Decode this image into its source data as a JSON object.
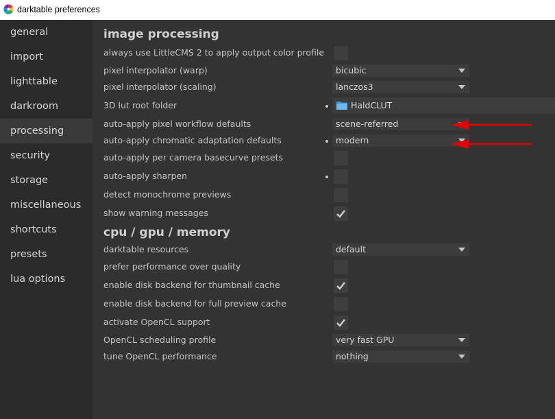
{
  "window": {
    "title": "darktable preferences"
  },
  "sidebar": {
    "items": [
      {
        "label": "general"
      },
      {
        "label": "import"
      },
      {
        "label": "lighttable"
      },
      {
        "label": "darkroom"
      },
      {
        "label": "processing",
        "active": true
      },
      {
        "label": "security"
      },
      {
        "label": "storage"
      },
      {
        "label": "miscellaneous"
      },
      {
        "label": "shortcuts"
      },
      {
        "label": "presets"
      },
      {
        "label": "lua options"
      }
    ]
  },
  "image_processing": {
    "title": "image processing",
    "rows": [
      {
        "label": "always use LittleCMS 2 to apply output color profile",
        "type": "checkbox",
        "checked": false
      },
      {
        "label": "pixel interpolator (warp)",
        "type": "select",
        "value": "bicubic"
      },
      {
        "label": "pixel interpolator (scaling)",
        "type": "select",
        "value": "lanczos3"
      },
      {
        "label": "3D lut root folder",
        "type": "folder",
        "value": "HaldCLUT",
        "modified": true
      },
      {
        "label": "auto-apply pixel workflow defaults",
        "type": "select",
        "value": "scene-referred"
      },
      {
        "label": "auto-apply chromatic adaptation defaults",
        "type": "select",
        "value": "modern",
        "modified": true
      },
      {
        "label": "auto-apply per camera basecurve presets",
        "type": "checkbox",
        "checked": false
      },
      {
        "label": "auto-apply sharpen",
        "type": "checkbox",
        "checked": false,
        "modified": true
      },
      {
        "label": "detect monochrome previews",
        "type": "checkbox",
        "checked": false
      },
      {
        "label": "show warning messages",
        "type": "checkbox",
        "checked": true
      }
    ]
  },
  "cpu_gpu_memory": {
    "title": "cpu / gpu / memory",
    "rows": [
      {
        "label": "darktable resources",
        "type": "select",
        "value": "default"
      },
      {
        "label": "prefer performance over quality",
        "type": "checkbox",
        "checked": false
      },
      {
        "label": "enable disk backend for thumbnail cache",
        "type": "checkbox",
        "checked": true
      },
      {
        "label": "enable disk backend for full preview cache",
        "type": "checkbox",
        "checked": false
      },
      {
        "label": "activate OpenCL support",
        "type": "checkbox",
        "checked": true
      },
      {
        "label": "OpenCL scheduling profile",
        "type": "select",
        "value": "very fast GPU"
      },
      {
        "label": "tune OpenCL performance",
        "type": "select",
        "value": "nothing"
      }
    ]
  },
  "colors": {
    "annotation_arrow": "#e00000",
    "checkmark": "#d0d0d0",
    "folder": "#5aa9e6"
  }
}
